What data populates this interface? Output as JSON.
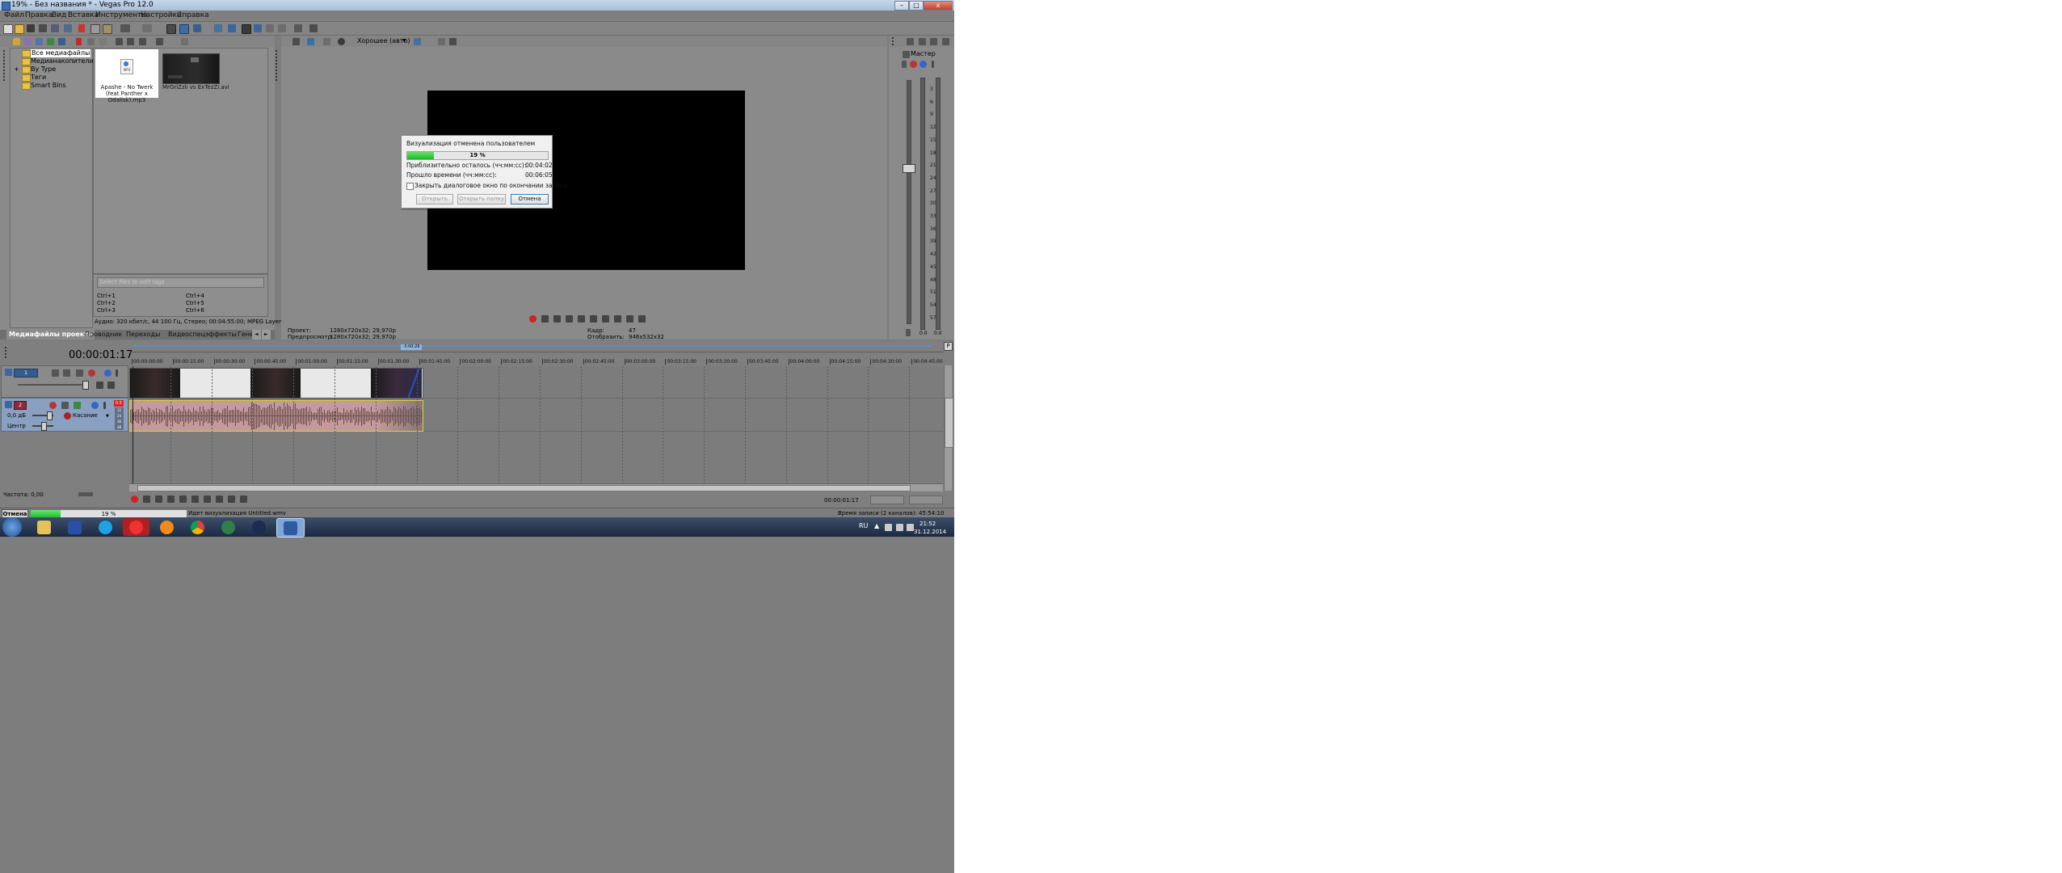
{
  "window": {
    "title": "19% - Без названия * - Vegas Pro 12.0",
    "minimize": "–",
    "maximize": "□",
    "close": "x"
  },
  "menu": [
    "Файл",
    "Правка",
    "Вид",
    "Вставка",
    "Инструменты",
    "Настройки",
    "Справка"
  ],
  "explorer": {
    "tree": [
      "Все медиафайлы",
      "Медианакопители",
      "By Type",
      "Теги",
      "Smart Bins"
    ],
    "expand_glyph": "+",
    "media": [
      {
        "name": "Apashe - No Twerk (feat Panther x Odalisk).mp3",
        "badge": "MP3",
        "icon": "audio-file-icon"
      },
      {
        "name": "MrGriZzli vs ExTezZi.avi",
        "icon": "video-thumbnail"
      }
    ],
    "tags_placeholder": "Select files to edit tags",
    "shortcuts": [
      "Ctrl+1",
      "Ctrl+4",
      "Ctrl+2",
      "Ctrl+5",
      "Ctrl+3",
      "Ctrl+6"
    ],
    "info": "Аудио: 320 кбит/с, 44 100 Гц, Стерео; 00:04:55:00; MPEG Layer-3",
    "tabs": [
      "Медиафайлы проекта",
      "Проводник",
      "Переходы",
      "Видеоспецэффекты",
      "Гене..."
    ]
  },
  "preview": {
    "quality": "Хорошее (авто)",
    "project_label": "Проект:",
    "project_value": "1280x720x32; 29,970p",
    "preview_label": "Предпросмотр:",
    "preview_value": "1280x720x32; 29,970p",
    "frame_label": "Кадр:",
    "frame_value": "47",
    "display_label": "Отобразить:",
    "display_value": "946x532x32"
  },
  "dialog": {
    "title": "Визуализация отменена пользователем",
    "progress_text": "19 %",
    "progress": 0.19,
    "remaining_label": "Приблизительно осталось (чч:мм:сс):",
    "remaining_value": "00:04:02",
    "elapsed_label": "Прошло времени (чч:мм:сс):",
    "elapsed_value": "00:06:05",
    "close_checkbox": "Закрыть диалоговое окно по окончании записи",
    "btn_open": "Открыть",
    "btn_open_folder": "Открыть папку",
    "btn_cancel": "Отмена"
  },
  "master": {
    "label": "Мастер",
    "scale": [
      "3",
      "6",
      "9",
      "12",
      "15",
      "18",
      "21",
      "24",
      "27",
      "30",
      "33",
      "36",
      "39",
      "42",
      "45",
      "48",
      "51",
      "54",
      "57"
    ],
    "peak_left": "0.0",
    "peak_right": "0.0"
  },
  "timeline": {
    "timecode": "00:00:01:17",
    "ruler": [
      "00:00:00:00",
      "00:00:15:00",
      "00:00:30:00",
      "00:00:45:00",
      "00:01:00:00",
      "00:01:15:00",
      "00:01:30:00",
      "00:01:45:00",
      "00:02:00:00",
      "00:02:15:00",
      "00:02:30:00",
      "00:02:45:00",
      "00:03:00:00",
      "00:03:15:00",
      "00:03:30:00",
      "00:03:45:00",
      "00:04:00:00",
      "00:04:15:00",
      "00:04:30:00",
      "00:04:45:00"
    ],
    "region_marker": "-3:00:26",
    "video_track_num": "1",
    "audio_track_num": "2",
    "audio_volume": "0,0 дБ",
    "audio_pan": "Центр",
    "audio_mode": "Касание",
    "audio_level_badge": "0.5",
    "audio_scale": [
      "12",
      "24",
      "36",
      "48"
    ],
    "rate": "Частота: 0,00",
    "cursor_time": "00:00:01:17",
    "record_time": "Время записи (2 каналов): 45:54:10"
  },
  "status": {
    "cancel": "Отмена",
    "percent": "19 %",
    "progress": 0.19,
    "message": "Идет визуализация Untitled.wmv"
  },
  "taskbar": {
    "lang": "RU",
    "time": "21:52",
    "date": "31.12.2014"
  },
  "colors": {
    "audio_event": "#c49a9a",
    "progress_green": "#27c032",
    "dialog_bg": "#f0f0f0"
  }
}
